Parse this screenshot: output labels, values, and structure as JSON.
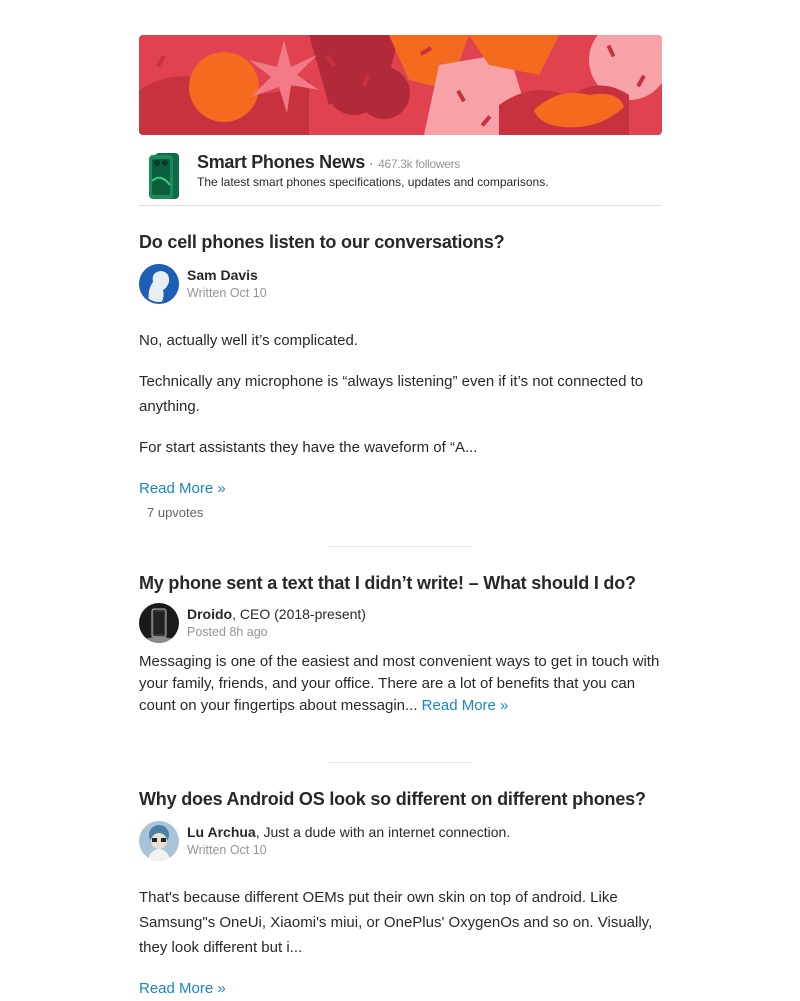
{
  "space": {
    "name": "Smart Phones News",
    "followers": "467.3k followers",
    "separator": "·",
    "description": "The latest smart phones specifications, updates and comparisons."
  },
  "colors": {
    "banner_bg": "#e0424f",
    "link": "#1a84c7",
    "muted": "#939598"
  },
  "posts": [
    {
      "title": "Do cell phones listen to our conversations?",
      "author": "Sam Davis",
      "credential": "",
      "meta": "Written Oct 10",
      "paragraphs": [
        "No, actually well it’s complicated.",
        "Technically any microphone is “always listening” even if it’s not connected to anything.",
        "For start assistants they have the waveform of “A..."
      ],
      "read_more": "Read More »",
      "upvotes": "7 upvotes"
    },
    {
      "title": "My phone sent a text that I didn’t write! – What should I do?",
      "author": "Droido",
      "credential": ", CEO (2018-present)",
      "meta": "Posted 8h ago",
      "body": "Messaging is one of the easiest and most convenient ways to get in touch with your family, friends, and your office. There are a lot of benefits that you can count on your fingertips about messagin...",
      "read_more": "Read More »"
    },
    {
      "title": "Why does Android OS look so different on different phones?",
      "author": "Lu Archua",
      "credential": ", Just a dude with an internet connection.",
      "meta": "Written Oct 10",
      "body": "That's because different OEMs put their own skin on top of android. Like Samsung\"s OneUi, Xiaomi's miui, or OnePlus' OxygenOs and so on. Visually, they look different but i...",
      "read_more": "Read More »"
    }
  ]
}
